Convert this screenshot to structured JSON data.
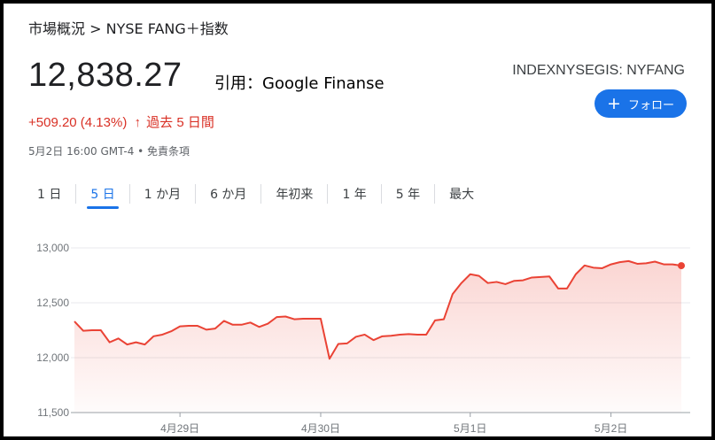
{
  "breadcrumb": {
    "parent": "市場概況",
    "separator": ">",
    "current": "NYSE FANG＋指数"
  },
  "quote": {
    "price": "12,838.27",
    "source": "引用：Google Finanse",
    "ticker": "INDEXNYSEGIS: NYFANG",
    "change": "+509.20 (4.13%)",
    "arrow": "↑",
    "period": "過去 5 日間",
    "timestamp": "5月2日 16:00 GMT-4 • 免責条項"
  },
  "follow_button": {
    "plus": "+",
    "label": "フォロー"
  },
  "tabs": [
    "1 日",
    "5 日",
    "1 か月",
    "6 か月",
    "年初来",
    "1 年",
    "5 年",
    "最大"
  ],
  "active_tab": "5 日",
  "colors": {
    "accent": "#1a73e8",
    "down": "#d93025",
    "line": "#ea4335",
    "fill": "#fce8e6"
  },
  "chart_data": {
    "type": "area",
    "ylim": [
      11500,
      13000
    ],
    "yticks": [
      "13,000",
      "12,500",
      "12,000",
      "11,500"
    ],
    "ytick_values": [
      13000,
      12500,
      12000,
      11500
    ],
    "xticks": [
      "4月29日",
      "4月30日",
      "5月1日",
      "5月2日"
    ],
    "xtick_index": [
      12,
      28,
      45,
      61
    ],
    "values": [
      12330,
      12245,
      12250,
      12250,
      12140,
      12175,
      12120,
      12140,
      12120,
      12195,
      12210,
      12240,
      12285,
      12290,
      12290,
      12255,
      12265,
      12335,
      12300,
      12300,
      12320,
      12280,
      12310,
      12370,
      12375,
      12350,
      12355,
      12355,
      12355,
      11990,
      12125,
      12130,
      12190,
      12210,
      12160,
      12195,
      12200,
      12210,
      12215,
      12210,
      12210,
      12340,
      12350,
      12580,
      12680,
      12760,
      12745,
      12680,
      12690,
      12670,
      12700,
      12705,
      12730,
      12735,
      12740,
      12630,
      12630,
      12760,
      12840,
      12820,
      12815,
      12850,
      12870,
      12880,
      12855,
      12860,
      12875,
      12850,
      12850,
      12838
    ]
  }
}
